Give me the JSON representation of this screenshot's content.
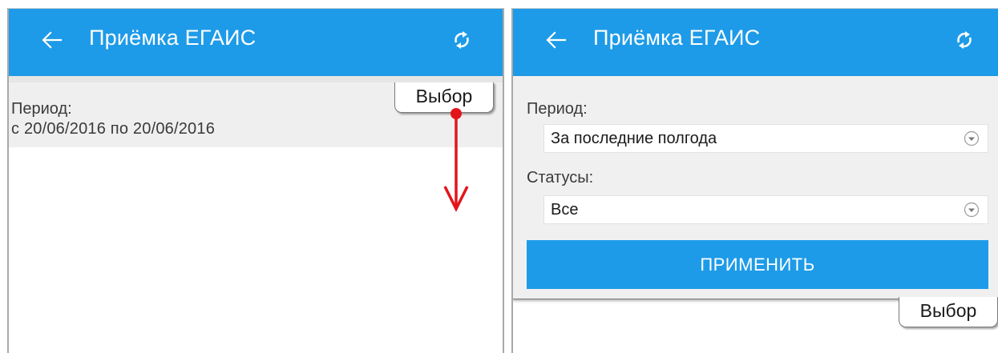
{
  "app": {
    "title": "Приёмка ЕГАИС"
  },
  "left_screen": {
    "period_label": "Период:",
    "period_value": "с 20/06/2016 по 20/06/2016",
    "tab_label": "Выбор"
  },
  "right_screen": {
    "period_label": "Период:",
    "period_selected": "За последние полгода",
    "status_label": "Статусы:",
    "status_selected": "Все",
    "apply_label": "ПРИМЕНИТЬ",
    "tab_label": "Выбор"
  },
  "colors": {
    "appbar": "#1e9be8",
    "gesture": "#e3151a",
    "panel": "#f0f0f0"
  },
  "icons": [
    "back-arrow-icon",
    "refresh-icon",
    "dropdown-icon",
    "drag-down-arrow-icon"
  ]
}
